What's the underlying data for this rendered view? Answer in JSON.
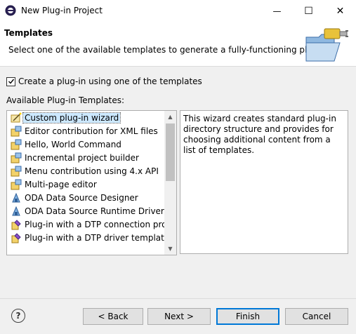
{
  "window": {
    "title": "New Plug-in Project",
    "minimize_glyph": "—",
    "maximize_glyph": "☐",
    "close_glyph": "✕"
  },
  "header": {
    "title": "Templates",
    "description": "Select one of the available templates to generate a fully-functioning plug-in."
  },
  "checkbox": {
    "label": "Create a plug-in using one of the templates",
    "checked": true
  },
  "available_label": "Available Plug-in Templates:",
  "templates": [
    {
      "label": "Custom plug-in wizard",
      "icon": "wand-icon",
      "selected": true
    },
    {
      "label": "Editor contribution for XML files",
      "icon": "template-icon"
    },
    {
      "label": "Hello, World Command",
      "icon": "template-icon"
    },
    {
      "label": "Incremental project builder",
      "icon": "template-icon"
    },
    {
      "label": "Menu contribution using 4.x API",
      "icon": "template-icon"
    },
    {
      "label": "Multi-page editor",
      "icon": "template-icon"
    },
    {
      "label": "ODA Data Source Designer",
      "icon": "data-source-icon"
    },
    {
      "label": "ODA Data Source Runtime Driver",
      "icon": "data-source-icon"
    },
    {
      "label": "Plug-in with a DTP connection profile",
      "icon": "plugin-icon"
    },
    {
      "label": "Plug-in with a DTP driver template",
      "icon": "plugin-icon"
    }
  ],
  "description_text": "This wizard creates standard plug-in directory structure and provides for choosing additional content from a list of templates.",
  "buttons": {
    "help": "?",
    "back": "< Back",
    "next": "Next >",
    "finish": "Finish",
    "cancel": "Cancel"
  },
  "colors": {
    "selection": "#cce8ff",
    "default_button_border": "#0078d7"
  }
}
